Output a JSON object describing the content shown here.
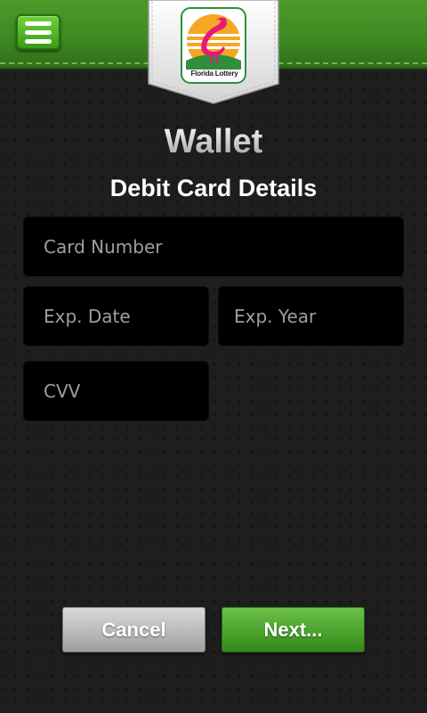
{
  "header": {
    "menu_icon": "hamburger-menu-icon",
    "logo_text": "Florida Lottery",
    "logo_icon": "flamingo-sun-logo",
    "colors": {
      "header_green": "#3f8a22",
      "menu_button_green": "#4fb524"
    }
  },
  "page": {
    "title": "Wallet",
    "section_title": "Debit Card Details"
  },
  "form": {
    "card_number_placeholder": "Card Number",
    "card_number_value": "",
    "exp_date_placeholder": "Exp. Date",
    "exp_date_value": "",
    "exp_year_placeholder": "Exp. Year",
    "exp_year_value": "",
    "cvv_placeholder": "CVV",
    "cvv_value": ""
  },
  "actions": {
    "cancel_label": "Cancel",
    "next_label": "Next...",
    "colors": {
      "cancel": "#bdbdbd",
      "next": "#4aa52d"
    }
  }
}
